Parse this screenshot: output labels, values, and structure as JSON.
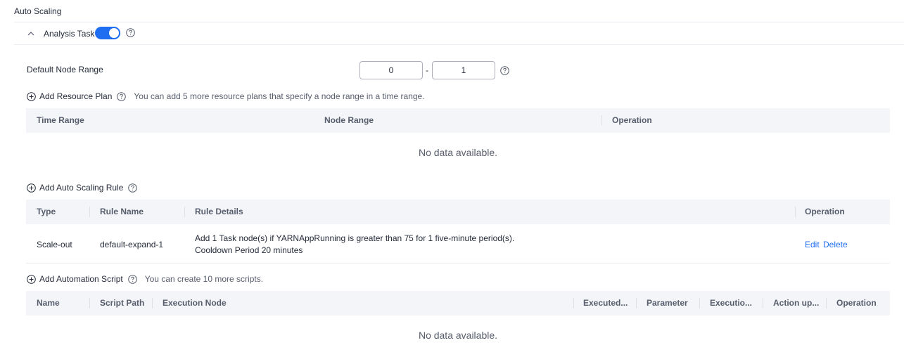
{
  "section": {
    "title": "Auto Scaling"
  },
  "task": {
    "label": "Analysis Task",
    "enabled": true,
    "toggle_color": "#1f6ef2"
  },
  "node_range": {
    "label": "Default Node Range",
    "min": "0",
    "separator": "-",
    "max": "1"
  },
  "resource_plan": {
    "add_label": "Add Resource Plan",
    "hint": "You can add 5 more resource plans that specify a node range in a time range.",
    "columns": [
      "Time Range",
      "Node Range",
      "Operation"
    ],
    "empty_text": "No data available."
  },
  "scaling_rule": {
    "add_label": "Add Auto Scaling Rule",
    "columns": [
      "Type",
      "Rule Name",
      "Rule Details",
      "Operation"
    ],
    "rows": [
      {
        "type": "Scale-out",
        "name": "default-expand-1",
        "details_line1": "Add 1 Task node(s) if YARNAppRunning is greater than 75 for 1 five-minute period(s).",
        "details_line2": "Cooldown Period 20 minutes",
        "edit": "Edit",
        "delete": "Delete"
      }
    ]
  },
  "automation_script": {
    "add_label": "Add Automation Script",
    "hint": "You can create 10 more scripts.",
    "columns": [
      "Name",
      "Script Path",
      "Execution Node",
      "Executed...",
      "Parameter",
      "Executio...",
      "Action up...",
      "Operation"
    ],
    "empty_text": "No data available."
  },
  "icons": {
    "collapse": "chevron-up-icon",
    "help": "question-circle-icon",
    "add": "plus-circle-icon"
  },
  "colors": {
    "accent": "#1f6ef2",
    "header_bg": "#f3f5f8",
    "text": "#252b3a"
  }
}
